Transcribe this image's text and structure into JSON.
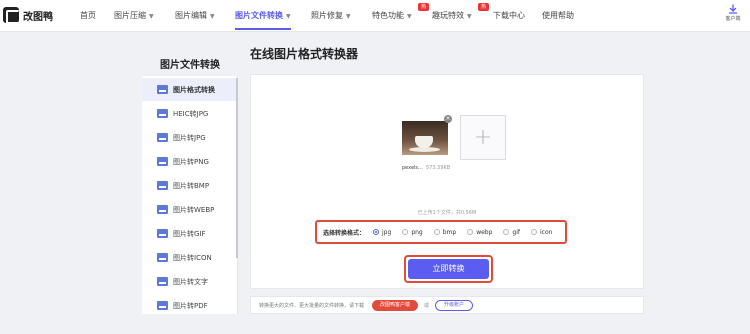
{
  "brand": {
    "name": "改图鸭"
  },
  "nav": {
    "items": [
      {
        "label": "首页"
      },
      {
        "label": "图片压缩"
      },
      {
        "label": "图片编辑"
      },
      {
        "label": "图片文件转换"
      },
      {
        "label": "照片修复"
      },
      {
        "label": "特色功能"
      },
      {
        "label": "趣玩特效"
      },
      {
        "label": "下载中心"
      },
      {
        "label": "使用帮助"
      }
    ],
    "hot_badge": "热",
    "client_label": "客户端"
  },
  "sidebar": {
    "title": "图片文件转换",
    "items": [
      {
        "label": "图片格式转换"
      },
      {
        "label": "HEIC转JPG"
      },
      {
        "label": "图片转JPG"
      },
      {
        "label": "图片转PNG"
      },
      {
        "label": "图片转BMP"
      },
      {
        "label": "图片转WEBP"
      },
      {
        "label": "图片转GIF"
      },
      {
        "label": "图片转ICON"
      },
      {
        "label": "图片转文字"
      },
      {
        "label": "图片转PDF"
      }
    ]
  },
  "main": {
    "title": "在线图片格式转换器",
    "file": {
      "name": "pexels...",
      "size": "573.39KB"
    },
    "upload_hint": "已上传1个文件，共0.56M",
    "format_label": "选择转换格式：",
    "formats": [
      {
        "label": "jpg",
        "selected": true
      },
      {
        "label": "png",
        "selected": false
      },
      {
        "label": "bmp",
        "selected": false
      },
      {
        "label": "webp",
        "selected": false
      },
      {
        "label": "gif",
        "selected": false
      },
      {
        "label": "icon",
        "selected": false
      }
    ],
    "convert_label": "立即转换"
  },
  "bottom": {
    "text": "转换更大的文件、更大批量的文件转换，请下载",
    "download_label": "改图鸭客户端",
    "or_text": "或",
    "upgrade_label": "升级账户"
  },
  "colors": {
    "accent": "#5b5cf0",
    "highlight": "#e24a3b"
  }
}
